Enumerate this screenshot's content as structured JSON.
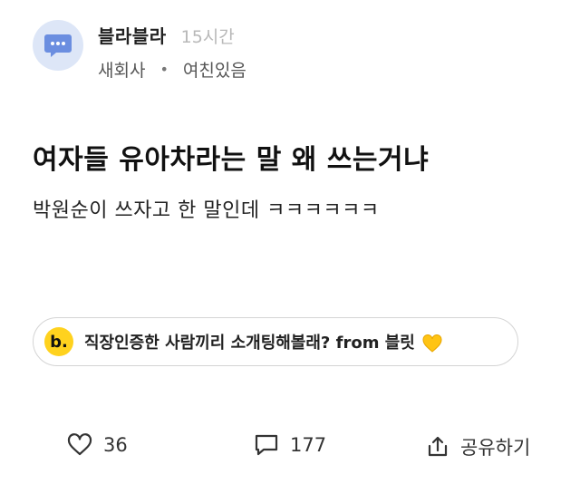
{
  "post": {
    "author": {
      "name": "블라블라",
      "time": "15시간",
      "company": "새회사",
      "separator": "•",
      "topic": "여친있음",
      "avatar_icon": "chat-bubble-icon",
      "avatar_bg": "#dde6f7"
    },
    "title": "여자들 유아차라는 말 왜 쓰는거냐",
    "body": "박원순이 쓰자고 한 말인데 ㅋㅋㅋㅋㅋㅋ"
  },
  "banner": {
    "logo_text": "b.",
    "logo_color": "#ffd21e",
    "text": "직장인증한 사람끼리 소개팅해볼래? from 블릿",
    "emoji_icon": "yellow-heart-icon"
  },
  "actions": {
    "likes": "36",
    "comments": "177",
    "share_label": "공유하기"
  }
}
